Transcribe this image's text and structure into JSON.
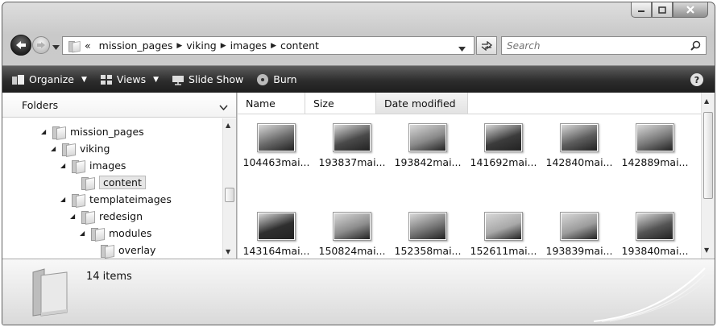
{
  "window": {
    "caption_buttons": [
      "minimize",
      "maximize",
      "close"
    ]
  },
  "nav": {
    "overflow_chevron": "«",
    "breadcrumb": [
      "mission_pages",
      "viking",
      "images",
      "content"
    ],
    "search_placeholder": "Search"
  },
  "toolbar": {
    "organize": "Organize",
    "views": "Views",
    "slideshow": "Slide Show",
    "burn": "Burn",
    "help": "?"
  },
  "folders_pane": {
    "header": "Folders",
    "tree": [
      {
        "label": "mission_pages",
        "depth": 0,
        "expanded": true
      },
      {
        "label": "viking",
        "depth": 1,
        "expanded": true
      },
      {
        "label": "images",
        "depth": 2,
        "expanded": true
      },
      {
        "label": "content",
        "depth": 3,
        "expanded": false,
        "selected": true
      },
      {
        "label": "templateimages",
        "depth": 2,
        "expanded": true
      },
      {
        "label": "redesign",
        "depth": 3,
        "expanded": true
      },
      {
        "label": "modules",
        "depth": 4,
        "expanded": true
      },
      {
        "label": "overlay",
        "depth": 5,
        "expanded": false
      }
    ]
  },
  "columns": [
    "Name",
    "Size",
    "Date modified"
  ],
  "files": [
    {
      "name": "104463mai...",
      "tone": "#6b6b6b"
    },
    {
      "name": "193837mai...",
      "tone": "#4a4a4a"
    },
    {
      "name": "193842mai...",
      "tone": "#8a8a8a"
    },
    {
      "name": "141692mai...",
      "tone": "#3c3c3c"
    },
    {
      "name": "142840mai...",
      "tone": "#5e5e5e"
    },
    {
      "name": "142889mai...",
      "tone": "#7a7a7a"
    },
    {
      "name": "143164mai...",
      "tone": "#2f2f2f"
    },
    {
      "name": "150824mai...",
      "tone": "#8d8d8d"
    },
    {
      "name": "152358mai...",
      "tone": "#777777"
    },
    {
      "name": "152611mai...",
      "tone": "#a8a8a8"
    },
    {
      "name": "193839mai...",
      "tone": "#9c9c9c"
    },
    {
      "name": "193840mai...",
      "tone": "#555555"
    }
  ],
  "status": {
    "item_count": "14 items"
  }
}
